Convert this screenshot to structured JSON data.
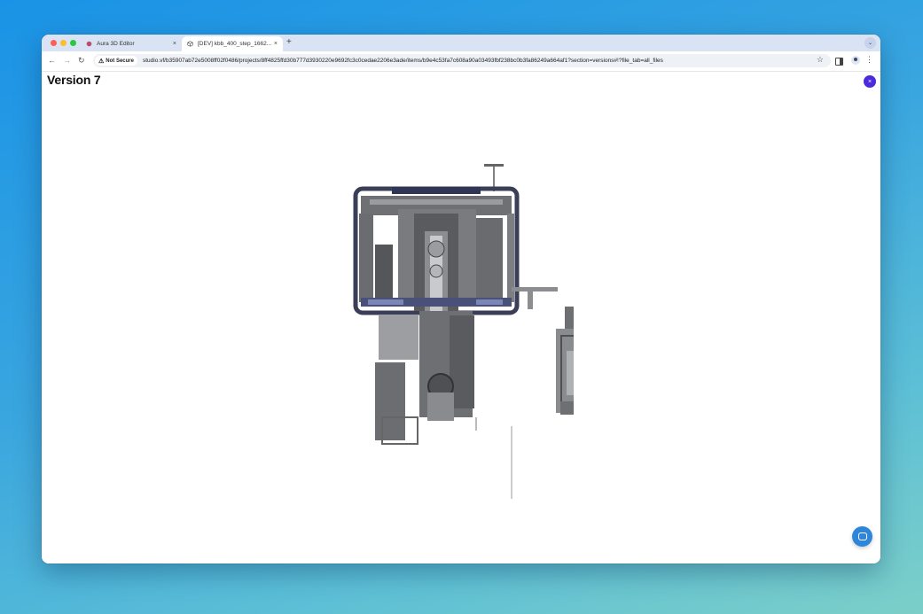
{
  "browser": {
    "tabs": [
      {
        "label": "Aura 3D Editor",
        "icon": "aura-logo-icon",
        "active": false
      },
      {
        "label": "[DEV] kbb_400_step_1662...",
        "icon": "cube-icon",
        "active": true
      }
    ],
    "new_tab_label": "+",
    "tab_menu_label": "⌄",
    "close_label": "×",
    "security_label": "Not Secure",
    "url": "studio.vf/b35907ab72e5008ff02f0486/projects/8ff4825ffd30b777d3930220e9692fc3c0cedae2206e3ade/items/b9e4c53fa7c608a90a03493fbf238bc0b3fa86249a664af1?section=versions#!?file_tab=all_files"
  },
  "page": {
    "title": "Version 7",
    "close_icon_label": "×"
  },
  "colors": {
    "accent": "#4b2bdc",
    "chat_button": "#2f86d9",
    "tab_bar": "#d9e3f3"
  }
}
